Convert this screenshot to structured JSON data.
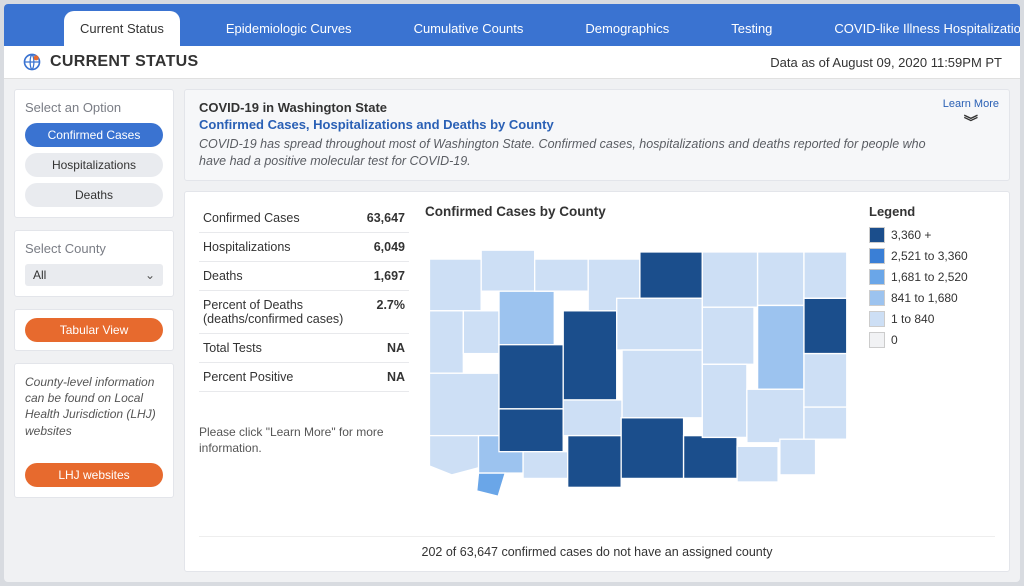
{
  "tabs": [
    {
      "label": "Current Status",
      "active": true
    },
    {
      "label": "Epidemiologic Curves"
    },
    {
      "label": "Cumulative Counts"
    },
    {
      "label": "Demographics"
    },
    {
      "label": "Testing"
    },
    {
      "label": "COVID-like Illness Hospitalizations"
    }
  ],
  "page_title": "CURRENT STATUS",
  "as_of": "Data as of August 09, 2020 11:59PM PT",
  "sidebar": {
    "select_option_title": "Select an Option",
    "options": [
      {
        "label": "Confirmed Cases",
        "active": true
      },
      {
        "label": "Hospitalizations"
      },
      {
        "label": "Deaths"
      }
    ],
    "select_county_title": "Select County",
    "county_selected": "All",
    "tabular_view": "Tabular View",
    "note": "County-level information can be found on Local Health Jurisdiction (LHJ) websites",
    "lhj_button": "LHJ websites"
  },
  "header_card": {
    "title": "COVID-19 in Washington State",
    "subtitle": "Confirmed Cases, Hospitalizations and Deaths by County",
    "text": "COVID-19 has spread throughout most of Washington State. Confirmed cases, hospitalizations and deaths reported for people who have had a positive molecular test for COVID-19.",
    "learn_more": "Learn More"
  },
  "stats": [
    {
      "label": "Confirmed Cases",
      "value": "63,647"
    },
    {
      "label": "Hospitalizations",
      "value": "6,049"
    },
    {
      "label": "Deaths",
      "value": "1,697"
    },
    {
      "label": "Percent of Deaths (deaths/confirmed cases)",
      "value": "2.7%"
    },
    {
      "label": "Total Tests",
      "value": "NA"
    },
    {
      "label": "Percent Positive",
      "value": "NA"
    }
  ],
  "stats_note": "Please click \"Learn More\" for more information.",
  "map_title": "Confirmed Cases by County",
  "footer_note": "202 of 63,647 confirmed cases do not have an assigned county",
  "legend_title": "Legend",
  "legend": [
    {
      "color": "#1b4e8c",
      "label": "3,360 +"
    },
    {
      "color": "#3a7fd6",
      "label": "2,521 to 3,360"
    },
    {
      "color": "#6aa6e8",
      "label": "1,681 to 2,520"
    },
    {
      "color": "#9cc3ef",
      "label": "841 to 1,680"
    },
    {
      "color": "#cddff5",
      "label": "1 to 840"
    },
    {
      "color": "#f1f2f4",
      "label": "0"
    }
  ]
}
